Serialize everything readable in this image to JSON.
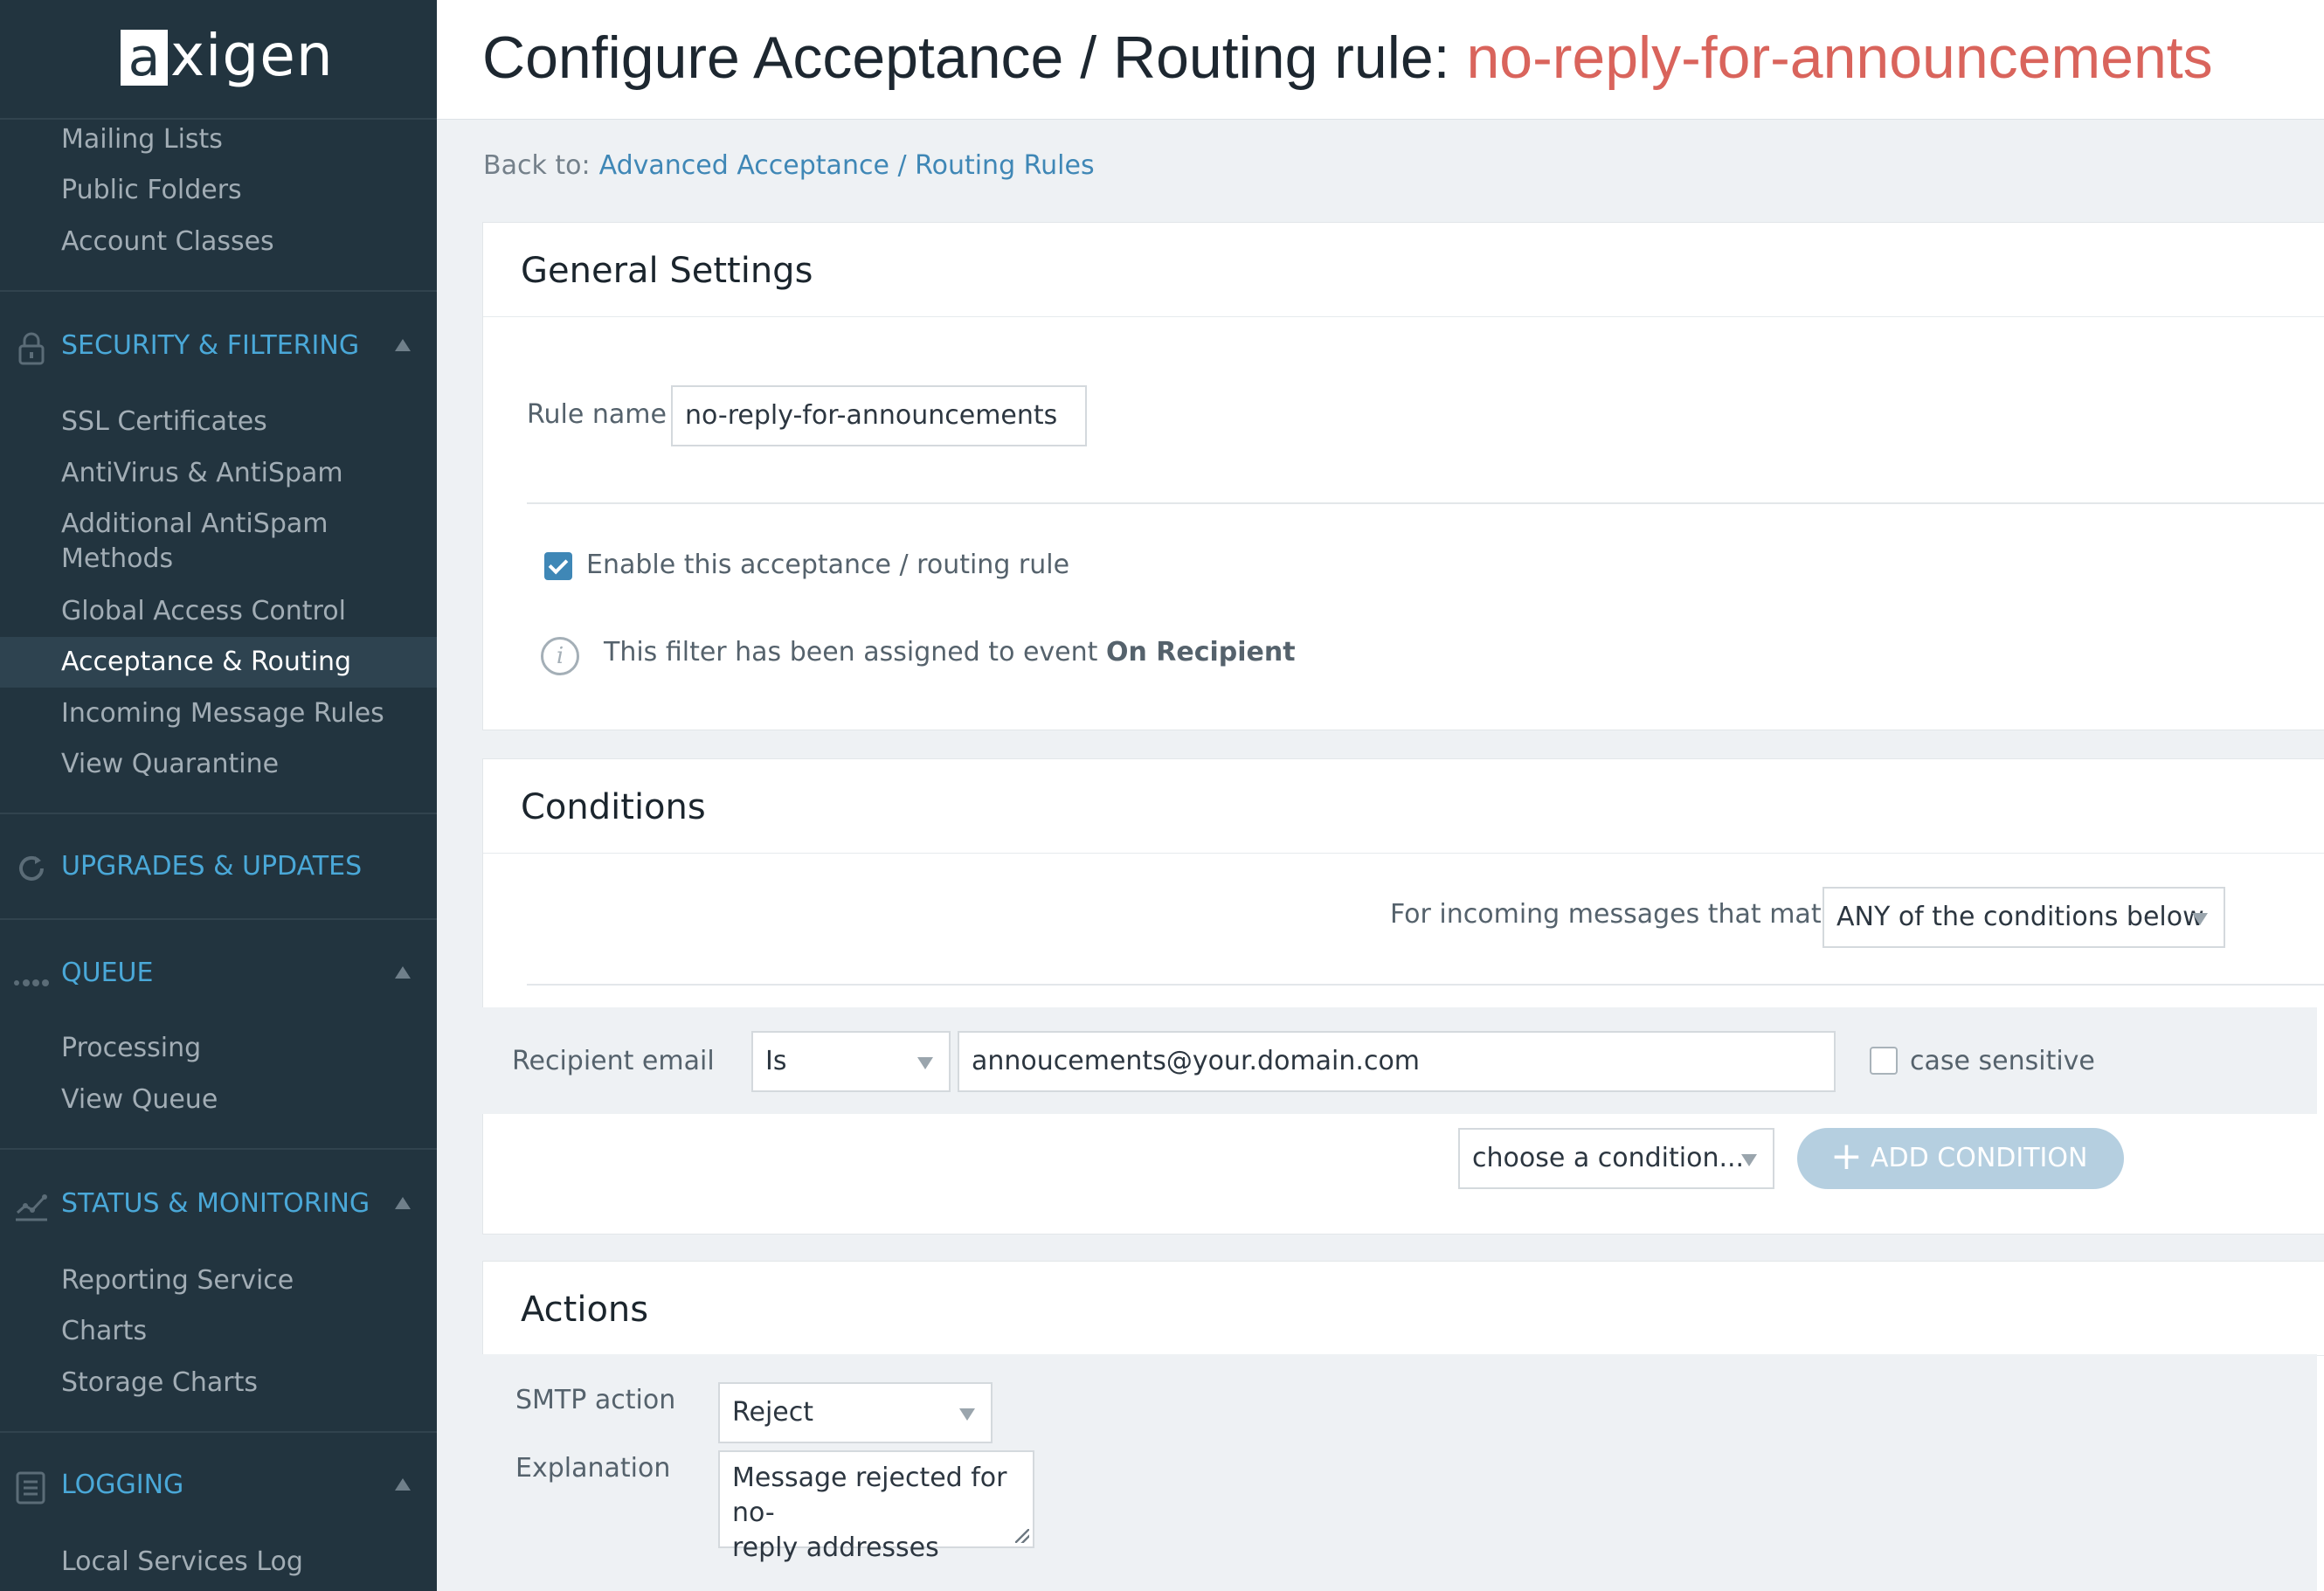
{
  "brand": {
    "logo_letter": "a",
    "logo_rest": "xigen"
  },
  "sidebar": {
    "top_items": [
      "Mailing Lists",
      "Public Folders",
      "Account Classes"
    ],
    "sections": [
      {
        "label": "SECURITY & FILTERING",
        "icon": "lock-icon",
        "items": [
          "SSL Certificates",
          "AntiVirus & AntiSpam",
          "Additional AntiSpam",
          "Methods",
          "Global Access Control",
          "Acceptance & Routing",
          "Incoming Message Rules",
          "View Quarantine"
        ]
      },
      {
        "label": "UPGRADES & UPDATES",
        "icon": "refresh-icon",
        "items": []
      },
      {
        "label": "QUEUE",
        "icon": "queue-dots-icon",
        "items": [
          "Processing",
          "View Queue"
        ]
      },
      {
        "label": "STATUS & MONITORING",
        "icon": "chart-line-icon",
        "items": [
          "Reporting Service",
          "Charts",
          "Storage Charts"
        ]
      },
      {
        "label": "LOGGING",
        "icon": "log-doc-icon",
        "items": [
          "Local Services Log"
        ]
      }
    ],
    "active_item": "Acceptance & Routing"
  },
  "header": {
    "title_prefix": "Configure Acceptance / Routing rule: ",
    "rule_name": "no-reply-for-announcements"
  },
  "breadcrumb": {
    "prefix": "Back to:",
    "link": "Advanced Acceptance / Routing Rules"
  },
  "general": {
    "title": "General Settings",
    "rule_name_label": "Rule name",
    "rule_name_value": "no-reply-for-announcements",
    "enable_label": "Enable this acceptance / routing rule",
    "enabled": true,
    "info_text": "This filter has been assigned to event ",
    "info_event": "On Recipient"
  },
  "conditions": {
    "title": "Conditions",
    "match_label": "For incoming messages that match",
    "match_value": "ANY of the conditions below",
    "rows": [
      {
        "field": "Recipient email",
        "operator": "Is",
        "value": "annoucements@your.domain.com",
        "case_label": "case sensitive",
        "case_sensitive": false
      }
    ],
    "choose_placeholder": "choose a condition...",
    "add_label": "ADD CONDITION"
  },
  "actions": {
    "title": "Actions",
    "smtp_label": "SMTP action",
    "smtp_value": "Reject",
    "explanation_label": "Explanation",
    "explanation_line1": "Message rejected for no-",
    "explanation_line2": "reply addresses"
  },
  "colors": {
    "sidebar_bg": "#22343f",
    "accent_blue": "#4aa8d8",
    "link_blue": "#3f87b6",
    "rule_red": "#d9645c",
    "add_btn": "#b5cfe0"
  }
}
